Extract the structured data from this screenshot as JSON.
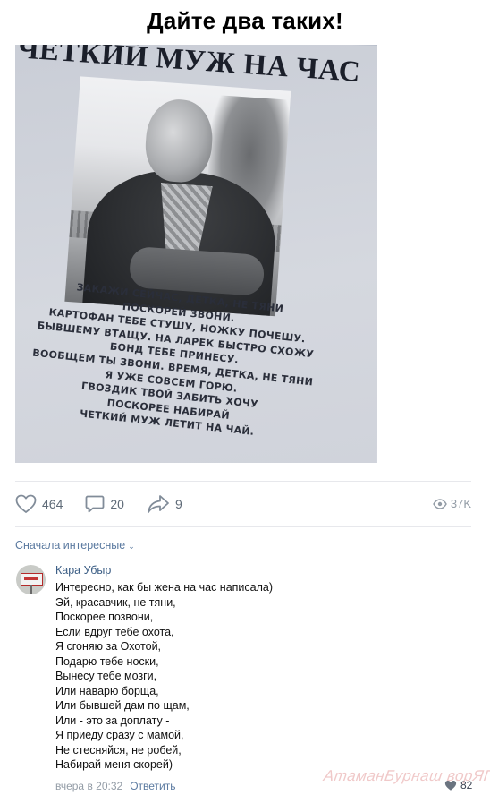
{
  "post": {
    "headline": "Дайте два таких!",
    "poster_title": "ЧЕТКИЙ МУЖ НА ЧАС",
    "poster_lines": [
      "ЗАКАЖИ СЕЙЧАС, ДЕТКА, НЕ ТЯНИ",
      "ПОСКОРЕЙ ЗВОНИ.",
      "КАРТОФАН ТЕБЕ СТУШУ, НОЖКУ ПОЧЕШУ.",
      "БЫВШЕМУ ВТАЩУ. НА ЛАРЕК БЫСТРО СХОЖУ",
      "БОНД ТЕБЕ ПРИНЕСУ.",
      "ВООБЩЕМ ТЫ ЗВОНИ. ВРЕМЯ, ДЕТКА, НЕ ТЯНИ",
      "Я УЖЕ СОВСЕМ ГОРЮ.",
      "ГВОЗДИК ТВОЙ ЗАБИТЬ ХОЧУ",
      "ПОСКОРЕЕ НАБИРАЙ",
      "ЧЕТКИЙ МУЖ ЛЕТИТ НА ЧАЙ."
    ]
  },
  "actions": {
    "likes": "464",
    "comments": "20",
    "shares": "9",
    "views": "37K"
  },
  "comments_section": {
    "sort_label": "Сначала интересные",
    "comment": {
      "author": "Кара Убыр",
      "lines": [
        "Интересно, как бы жена на час написала)",
        "Эй, красавчик, не тяни,",
        "Поскорее позвони,",
        "Если вдруг тебе охота,",
        "Я сгоняю за Охотой,",
        "Подарю тебе носки,",
        "Вынесу тебе мозги,",
        "Или наварю борща,",
        "Или бывшей дам по щам,",
        "Или - это за доплату -",
        "Я приеду сразу с мамой,",
        "Не стесняйся, не робей,",
        "Набирай меня скорей)"
      ],
      "time": "вчера в 20:32",
      "reply_label": "Ответить",
      "likes": "82"
    }
  },
  "watermark": "АтаманБурнаш ворЯП",
  "icons": {
    "like": "heart-icon",
    "comment": "comment-icon",
    "share": "share-arrow-icon",
    "views": "eye-icon",
    "comment_like": "heart-filled-icon"
  },
  "colors": {
    "link": "#5b7aa0",
    "author": "#3c5e85",
    "icon": "#818c99",
    "muted": "#939ca6"
  }
}
